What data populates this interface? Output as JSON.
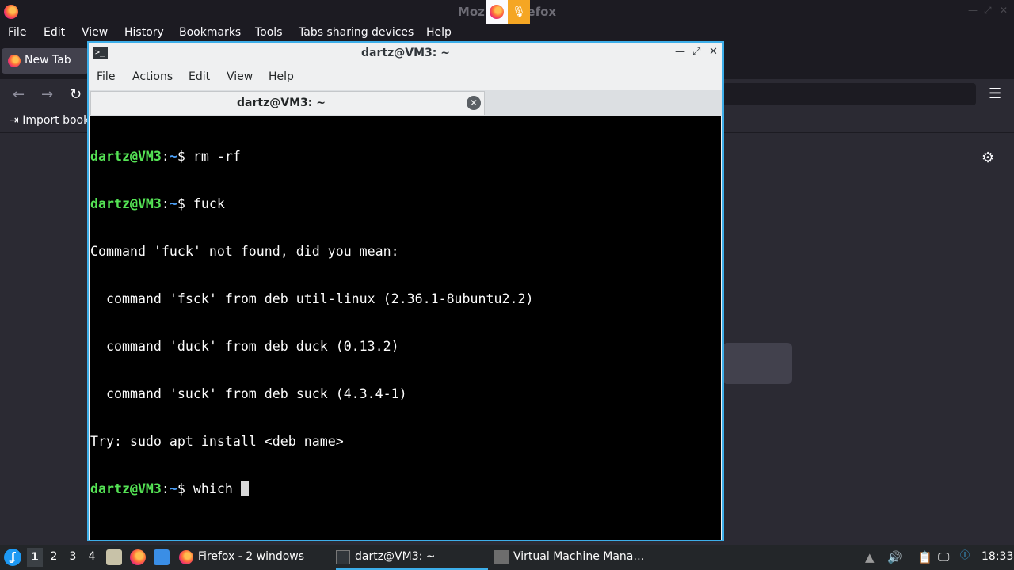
{
  "firefox": {
    "window_title": "Mozilla Firefox",
    "menu": [
      "File",
      "Edit",
      "View",
      "History",
      "Bookmarks",
      "Tools",
      "Tabs sharing devices",
      "Help"
    ],
    "tab_label": "New Tab",
    "import_bookmarks": "Import book",
    "overlay_mic": "🎙"
  },
  "terminal": {
    "window_title": "dartz@VM3: ~",
    "menu": [
      "File",
      "Actions",
      "Edit",
      "View",
      "Help"
    ],
    "tab_label": "dartz@VM3: ~",
    "prompt_user": "dartz@VM3",
    "prompt_sep": ":",
    "prompt_path": "~",
    "prompt_end": "$ ",
    "lines": {
      "l1_cmd": "rm -rf",
      "l2_cmd": "fuck",
      "l3": "Command 'fuck' not found, did you mean:",
      "l4": "  command 'fsck' from deb util-linux (2.36.1-8ubuntu2.2)",
      "l5": "  command 'duck' from deb duck (0.13.2)",
      "l6": "  command 'suck' from deb suck (4.3.4-1)",
      "l7": "Try: sudo apt install <deb name>",
      "l8_cmd": "which "
    }
  },
  "panel": {
    "workspaces": [
      "1",
      "2",
      "3",
      "4"
    ],
    "active_workspace": "1",
    "tasks": {
      "firefox": "Firefox - 2 windows",
      "terminal": "dartz@VM3: ~",
      "vmm": "Virtual Machine Mana…"
    },
    "clock": "18:33"
  },
  "colors": {
    "accent": "#3daee9",
    "prompt_user": "#55e455",
    "prompt_path": "#4c9ff6"
  }
}
